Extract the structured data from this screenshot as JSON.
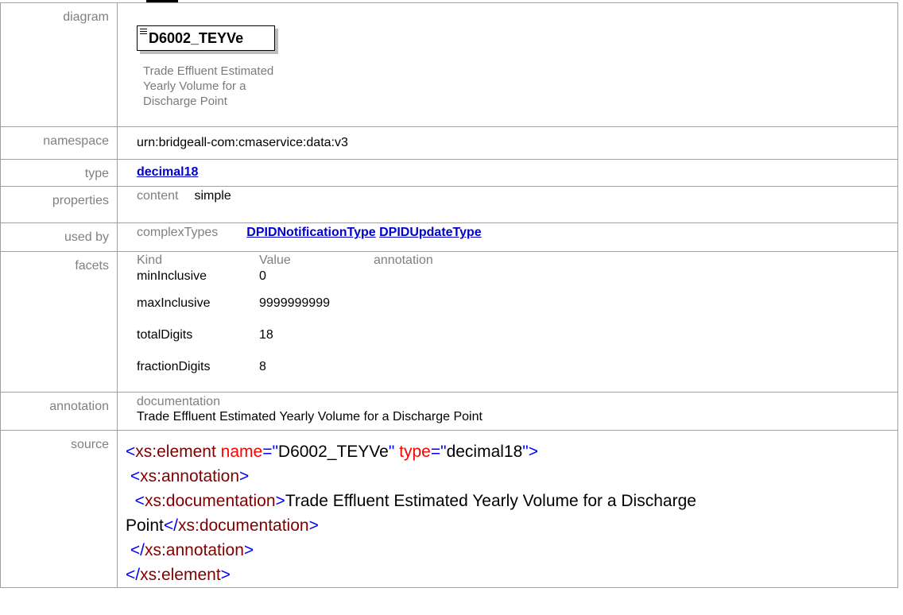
{
  "labels": {
    "diagram": "diagram",
    "namespace": "namespace",
    "type": "type",
    "properties": "properties",
    "used_by": "used by",
    "facets": "facets",
    "annotation": "annotation",
    "source": "source"
  },
  "diagram": {
    "element_name": "D6002_TEYVe",
    "doc_lines": [
      "Trade Effluent Estimated",
      "Yearly Volume for a",
      "Discharge Point"
    ]
  },
  "namespace": "urn:bridgeall-com:cmaservice:data:v3",
  "type": {
    "link": "decimal18"
  },
  "properties": {
    "key": "content",
    "value": "simple"
  },
  "used_by": {
    "kind": "complexTypes",
    "links": [
      "DPIDNotificationType",
      "DPIDUpdateType"
    ]
  },
  "facets": {
    "headers": [
      "Kind",
      "Value",
      "annotation"
    ],
    "rows": [
      {
        "kind": "minInclusive",
        "value": "0"
      },
      {
        "kind": "maxInclusive",
        "value": "9999999999"
      },
      {
        "kind": "totalDigits",
        "value": "18"
      },
      {
        "kind": "fractionDigits",
        "value": "8"
      }
    ]
  },
  "annotation": {
    "heading": "documentation",
    "text": "Trade Effluent Estimated Yearly Volume for a Discharge Point"
  },
  "source": {
    "l1": {
      "open": "<",
      "tag": "xs:element",
      "attr1": " name",
      "eq1": "=\"",
      "val1": "D6002_TEYVe",
      "q1": "\"",
      "attr2": " type",
      "eq2": "=\"",
      "val2": "decimal18",
      "q2": "\"",
      "close": ">"
    },
    "l2": {
      "indent": " ",
      "open": "<",
      "tag": "xs:annotation",
      "close": ">"
    },
    "l3": {
      "indent": "  ",
      "open": "<",
      "tag": "xs:documentation",
      "close": ">",
      "text": "Trade Effluent Estimated Yearly Volume for a Discharge"
    },
    "l4": {
      "text": "Point",
      "open": "</",
      "tag": "xs:documentation",
      "close": ">"
    },
    "l5": {
      "indent": " ",
      "open": "</",
      "tag": "xs:annotation",
      "close": ">"
    },
    "l6": {
      "open": "</",
      "tag": "xs:element",
      "close": ">"
    }
  }
}
